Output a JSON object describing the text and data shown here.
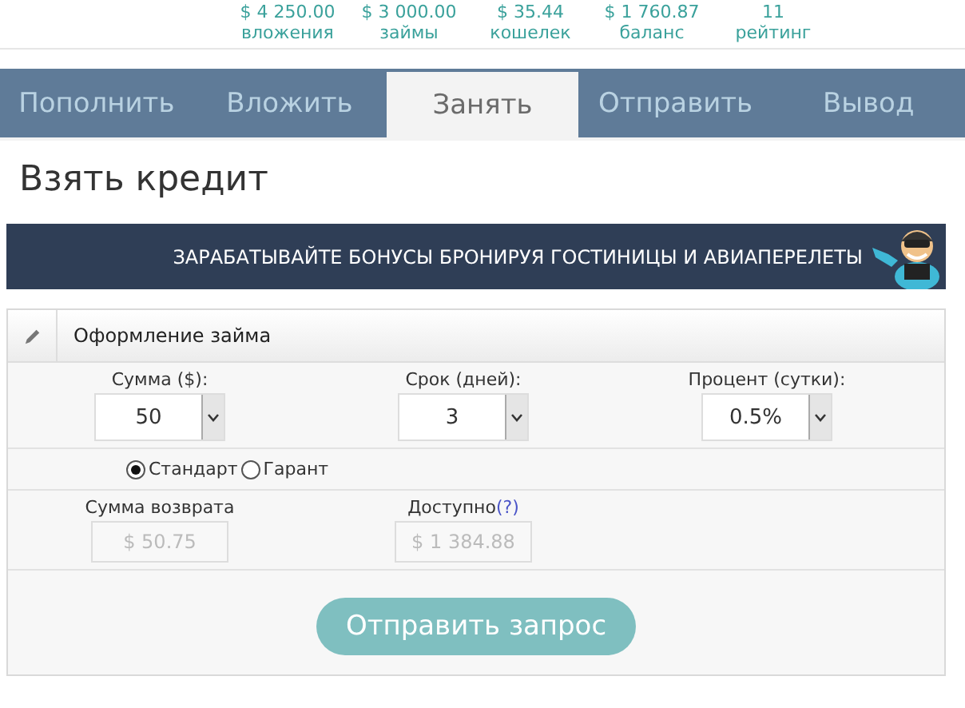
{
  "stats": [
    {
      "value": "$ 4 250.00",
      "label": "вложения"
    },
    {
      "value": "$ 3 000.00",
      "label": "займы"
    },
    {
      "value": "$ 35.44",
      "label": "кошелек"
    },
    {
      "value": "$ 1 760.87",
      "label": "баланс"
    },
    {
      "value": "11",
      "label": "рейтинг"
    }
  ],
  "tabs": [
    {
      "label": "Пополнить",
      "selected": false
    },
    {
      "label": "Вложить",
      "selected": false
    },
    {
      "label": "Занять",
      "selected": true
    },
    {
      "label": "Отправить",
      "selected": false
    },
    {
      "label": "Вывод",
      "selected": false
    }
  ],
  "page_title": "Взять кредит",
  "banner": {
    "text": "ЗАРАБАТЫВАЙТЕ БОНУСЫ БРОНИРУЯ ГОСТИНИЦЫ И АВИАПЕРЕЛЕТЫ"
  },
  "panel": {
    "title": "Оформление займа",
    "selects": [
      {
        "label": "Сумма ($):",
        "value": "50"
      },
      {
        "label": "Срок (дней):",
        "value": "3"
      },
      {
        "label": "Процент (сутки):",
        "value": "0.5%"
      }
    ],
    "radios": [
      {
        "label": "Стандарт",
        "selected": true
      },
      {
        "label": "Гарант",
        "selected": false
      }
    ],
    "outputs": [
      {
        "label": "Сумма возврата",
        "value": "$ 50.75"
      },
      {
        "label": "Доступно",
        "help": "(?)",
        "value": "$ 1 384.88"
      }
    ],
    "submit": "Отправить запрос"
  }
}
